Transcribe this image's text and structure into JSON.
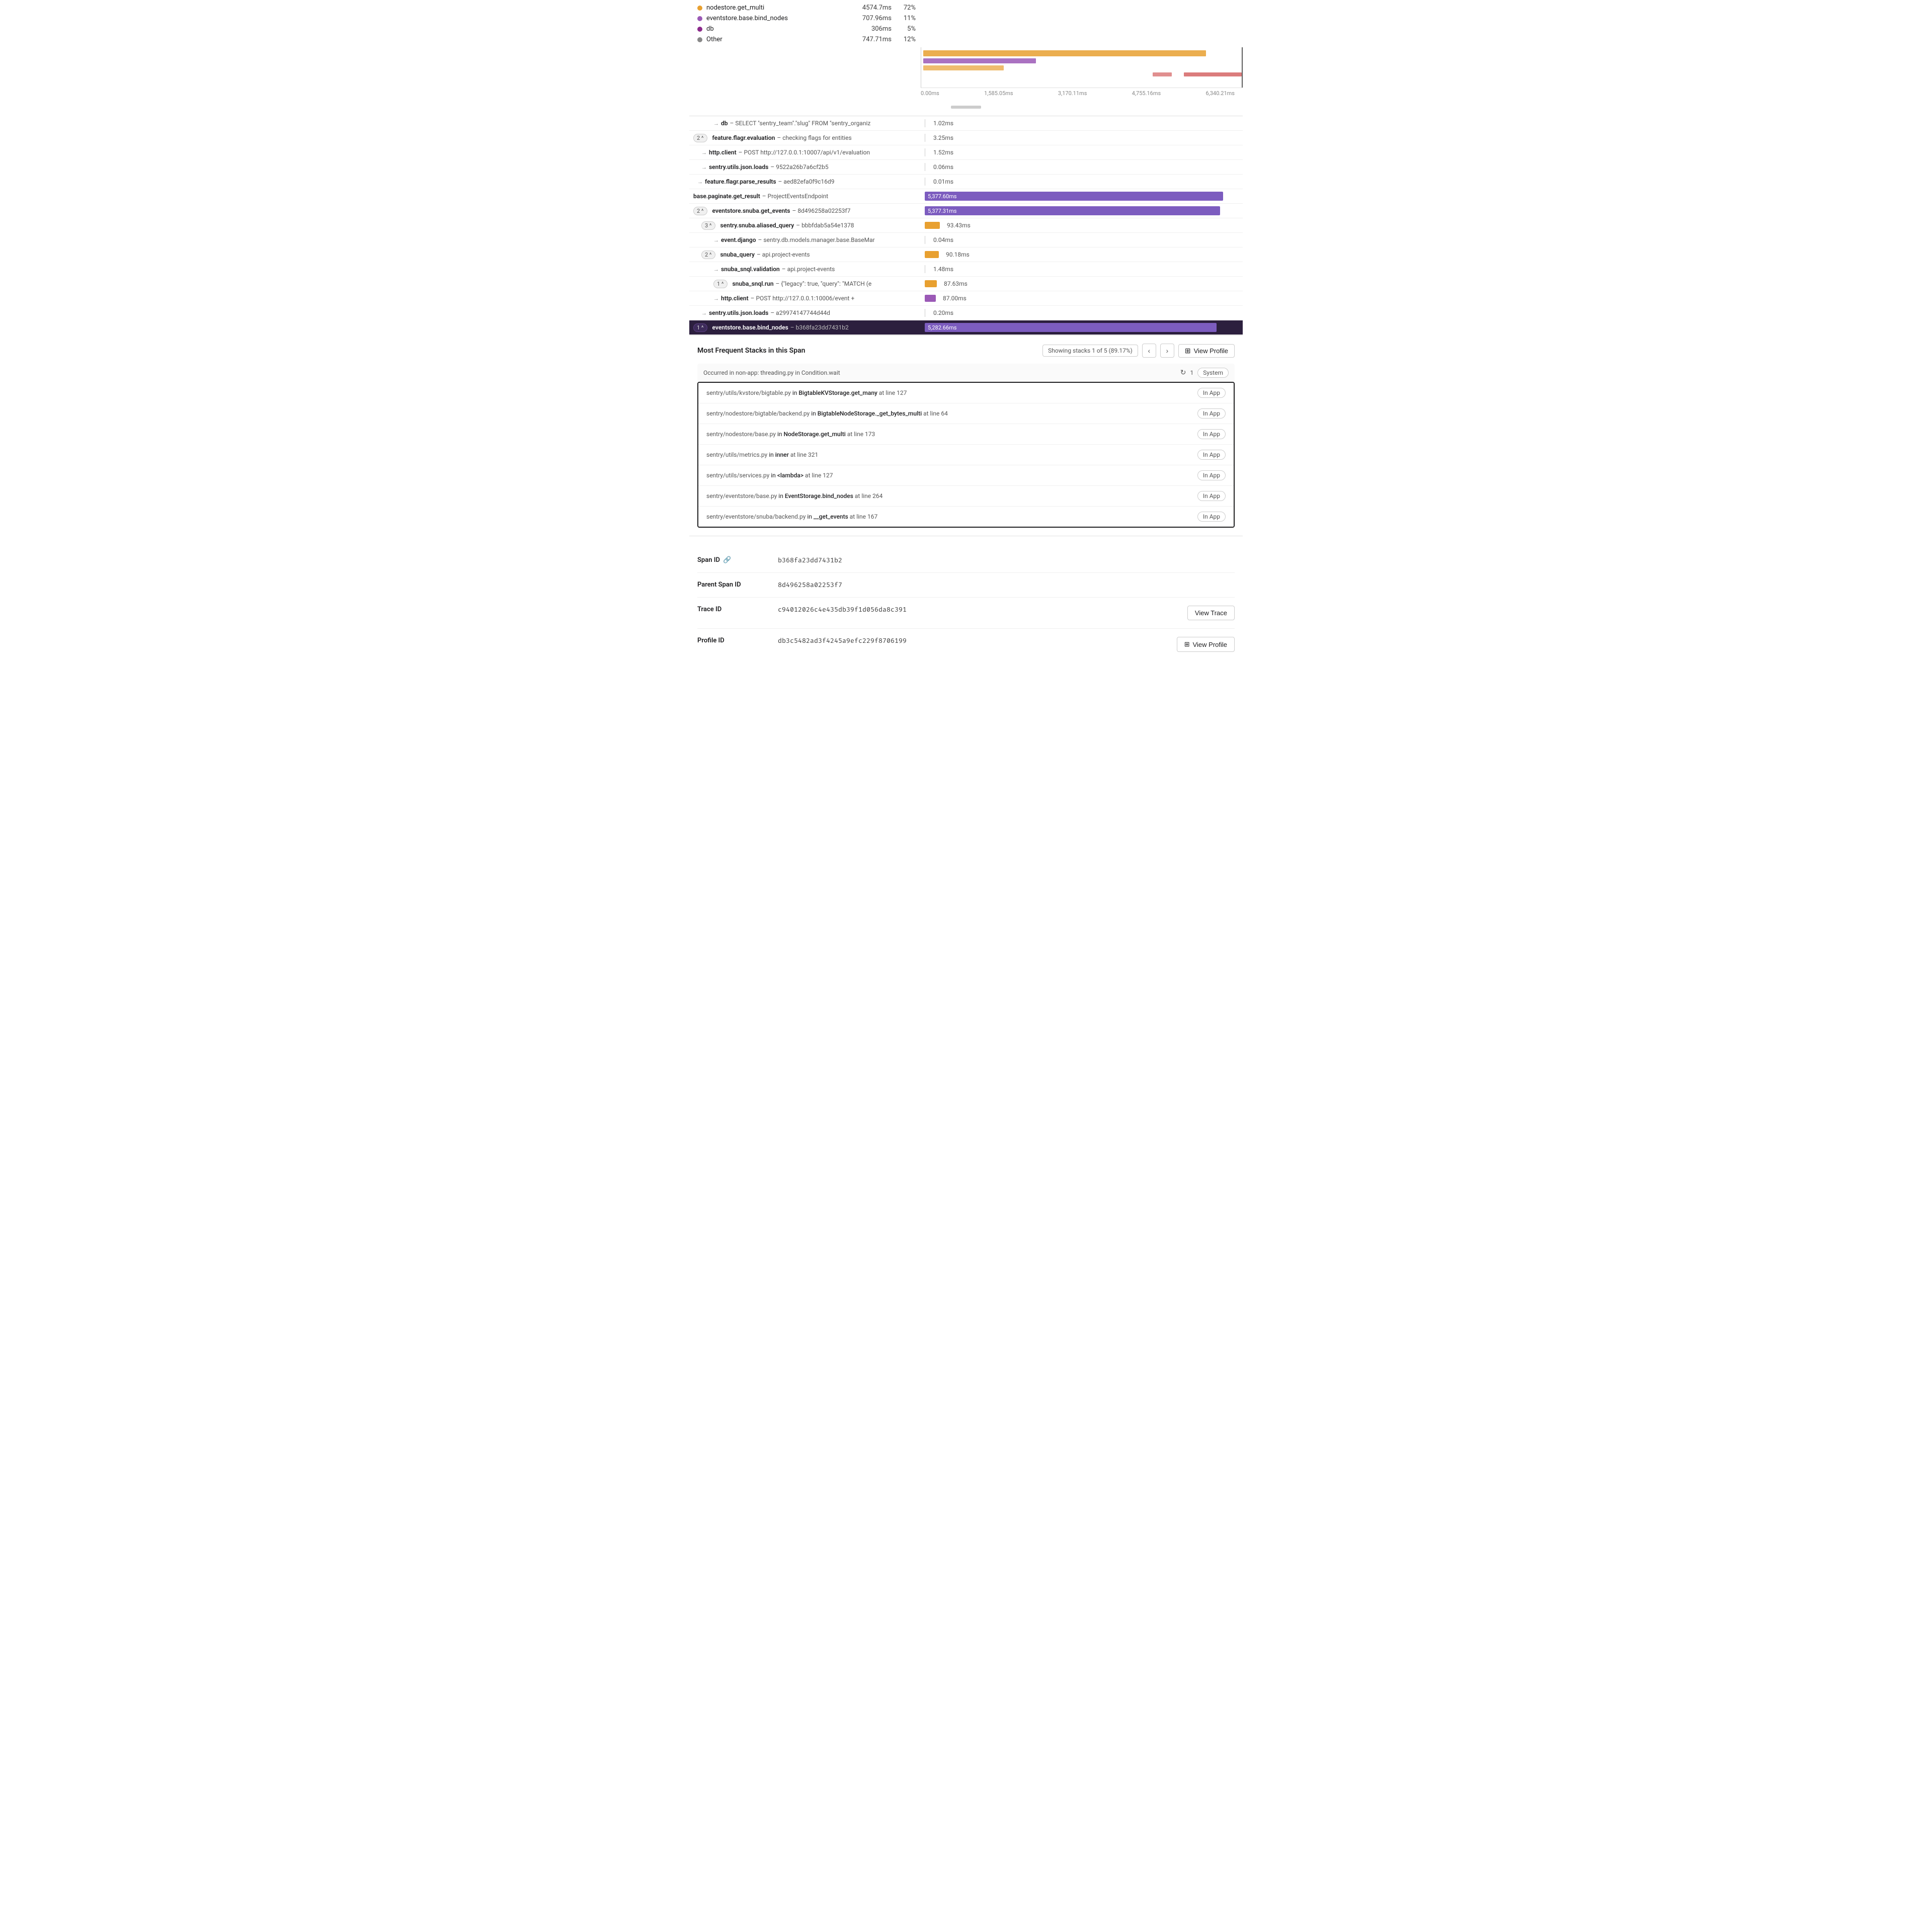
{
  "legend": {
    "items": [
      {
        "id": "nodestore",
        "color": "#e8a030",
        "name": "nodestore.get_multi",
        "time": "4574.7ms",
        "pct": "72%"
      },
      {
        "id": "eventstore",
        "color": "#9b59b6",
        "name": "eventstore.base.bind_nodes",
        "time": "707.96ms",
        "pct": "11%"
      },
      {
        "id": "db",
        "color": "#8b2a8b",
        "name": "db",
        "time": "306ms",
        "pct": "5%"
      },
      {
        "id": "other",
        "color": "#888",
        "name": "Other",
        "time": "747.71ms",
        "pct": "12%"
      }
    ]
  },
  "axis": {
    "labels": [
      "0.00ms",
      "1,585.05ms",
      "3,170.11ms",
      "4,755.16ms",
      "6,340.21ms"
    ]
  },
  "spans": [
    {
      "id": "s1",
      "indent": 1,
      "count": null,
      "name": "db",
      "desc": "– SELECT \"sentry_team\".\"slug\" FROM \"sentry_organiz",
      "duration": "1.02ms",
      "barType": "separator",
      "barWidth": 0
    },
    {
      "id": "s2",
      "indent": 0,
      "count": "2^",
      "name": "feature.flagr.evaluation",
      "desc": "– checking flags for entities",
      "duration": "3.25ms",
      "barType": "separator",
      "barWidth": 0
    },
    {
      "id": "s3",
      "indent": 1,
      "count": null,
      "name": "http.client",
      "desc": "– POST http://127.0.0.1:10007/api/v1/evaluation",
      "duration": "1.52ms",
      "barType": "separator",
      "barWidth": 0
    },
    {
      "id": "s4",
      "indent": 1,
      "count": null,
      "name": "sentry.utils.json.loads",
      "desc": "– 9522a26b7a6cf2b5",
      "duration": "0.06ms",
      "barType": "separator",
      "barWidth": 0
    },
    {
      "id": "s5",
      "indent": 0,
      "count": null,
      "name": "feature.flagr.parse_results",
      "desc": "– aed82efa0f9c16d9",
      "duration": "0.01ms",
      "barType": "separator",
      "barWidth": 0
    },
    {
      "id": "s6",
      "indent": 0,
      "count": null,
      "name": "base.paginate.get_result",
      "desc": "– ProjectEventsEndpoint",
      "duration": "5,377.60ms",
      "barType": "purple-full",
      "barWidth": 95
    },
    {
      "id": "s7",
      "indent": 0,
      "count": "2^",
      "name": "eventstore.snuba.get_events",
      "desc": "– 8d496258a02253f7",
      "duration": "5,377.31ms",
      "barType": "purple-full",
      "barWidth": 94
    },
    {
      "id": "s8",
      "indent": 1,
      "count": "3^",
      "name": "sentry.snuba.aliased_query",
      "desc": "– bbbfdab5a54e1378",
      "duration": "93.43ms",
      "barType": "orange-small",
      "barWidth": 3
    },
    {
      "id": "s9",
      "indent": 2,
      "count": null,
      "name": "event.django",
      "desc": "– sentry.db.models.manager.base.BaseMan",
      "duration": "0.04ms",
      "barType": "separator",
      "barWidth": 0
    },
    {
      "id": "s10",
      "indent": 1,
      "count": "2^",
      "name": "snuba_query",
      "desc": "– api.project-events",
      "duration": "90.18ms",
      "barType": "orange-small",
      "barWidth": 3
    },
    {
      "id": "s11",
      "indent": 2,
      "count": null,
      "name": "snuba_snql.validation",
      "desc": "– api.project-events",
      "duration": "1.48ms",
      "barType": "separator",
      "barWidth": 0
    },
    {
      "id": "s12",
      "indent": 2,
      "count": "1^",
      "name": "snuba_snql.run",
      "desc": "– {\"legacy\": true, \"query\": \"MATCH (e",
      "duration": "87.63ms",
      "barType": "orange-small",
      "barWidth": 2.5
    },
    {
      "id": "s13",
      "indent": 2,
      "count": null,
      "name": "http.client",
      "desc": "– POST http://127.0.0.1:10006/event +",
      "duration": "87.00ms",
      "barType": "orange-small",
      "barWidth": 2.5
    },
    {
      "id": "s14",
      "indent": 1,
      "count": null,
      "name": "sentry.utils.json.loads",
      "desc": "– a29974147744d44d",
      "duration": "0.20ms",
      "barType": "separator",
      "barWidth": 0
    },
    {
      "id": "s15",
      "indent": 0,
      "count": "1^",
      "name": "eventstore.base.bind_nodes",
      "desc": "– b368fa23dd7431b2",
      "duration": "5,282.66ms",
      "barType": "purple-full-highlighted",
      "barWidth": 93,
      "highlighted": true
    }
  ],
  "stacksSection": {
    "title": "Most Frequent Stacks in this Span",
    "counter": "Showing stacks 1 of 5 (89.17%)",
    "occurredText": "Occurred in non-app: threading.py in Condition.wait",
    "refreshCount": "1",
    "systemBadge": "System",
    "frames": [
      {
        "id": "f1",
        "path": "sentry/utils/kvstore/bigtable.py",
        "method": "BigtableKVStorage.get_many",
        "line": "127",
        "badge": "In App"
      },
      {
        "id": "f2",
        "path": "sentry/nodestore/bigtable/backend.py",
        "method": "BigtableNodeStorage._get_bytes_multi",
        "line": "64",
        "badge": "In App"
      },
      {
        "id": "f3",
        "path": "sentry/nodestore/base.py",
        "method": "NodeStorage.get_multi",
        "line": "173",
        "badge": "In App"
      },
      {
        "id": "f4",
        "path": "sentry/utils/metrics.py",
        "method": "inner",
        "line": "321",
        "badge": "In App"
      },
      {
        "id": "f5",
        "path": "sentry/utils/services.py",
        "method": "<lambda>",
        "line": "127",
        "badge": "In App"
      },
      {
        "id": "f6",
        "path": "sentry/eventstore/base.py",
        "method": "EventStorage.bind_nodes",
        "line": "264",
        "badge": "In App"
      },
      {
        "id": "f7",
        "path": "sentry/eventstore/snuba/backend.py",
        "method": "__get_events",
        "line": "167",
        "badge": "In App"
      }
    ]
  },
  "details": {
    "spanId": {
      "label": "Span ID",
      "value": "b368fa23dd7431b2"
    },
    "parentSpanId": {
      "label": "Parent Span ID",
      "value": "8d496258a02253f7"
    },
    "traceId": {
      "label": "Trace ID",
      "value": "c94012026c4e435db39f1d056da8c391",
      "action": "View Trace"
    },
    "profileId": {
      "label": "Profile ID",
      "value": "db3c5482ad3f4245a9efc229f8706199",
      "action": "View Profile"
    }
  },
  "buttons": {
    "prev": "‹",
    "next": "›",
    "viewProfileIcon": "⊞",
    "linkIcon": "🔗"
  }
}
